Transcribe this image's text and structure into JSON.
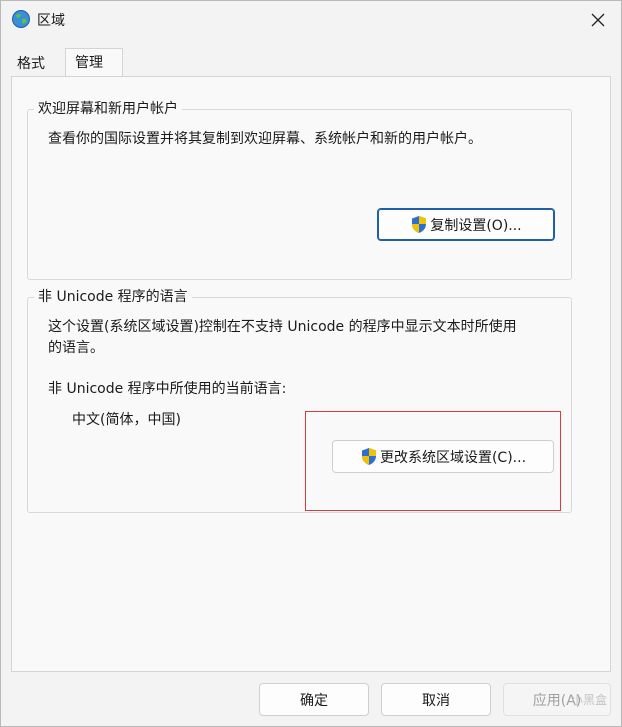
{
  "window": {
    "title": "区域"
  },
  "tabs": [
    {
      "label": "格式",
      "active": false
    },
    {
      "label": "管理",
      "active": true
    }
  ],
  "welcome_group": {
    "title": "欢迎屏幕和新用户帐户",
    "description": "查看你的国际设置并将其复制到欢迎屏幕、系统帐户和新的用户帐户。",
    "copy_button": "复制设置(O)..."
  },
  "unicode_group": {
    "title": "非 Unicode 程序的语言",
    "description_line1": "这个设置(系统区域设置)控制在不支持 Unicode 的程序中显示文本时所使用",
    "description_line2": "的语言。",
    "current_label": "非 Unicode 程序中所使用的当前语言:",
    "current_value": "中文(简体，中国)",
    "change_button": "更改系统区域设置(C)..."
  },
  "footer": {
    "ok": "确定",
    "cancel": "取消",
    "apply": "应用(A)"
  },
  "watermark": "小黑盒",
  "colors": {
    "highlight": "#e0383f",
    "focus_border": "#1f5fa8",
    "shield_blue": "#2b6fd6",
    "shield_yellow": "#f2c200"
  }
}
